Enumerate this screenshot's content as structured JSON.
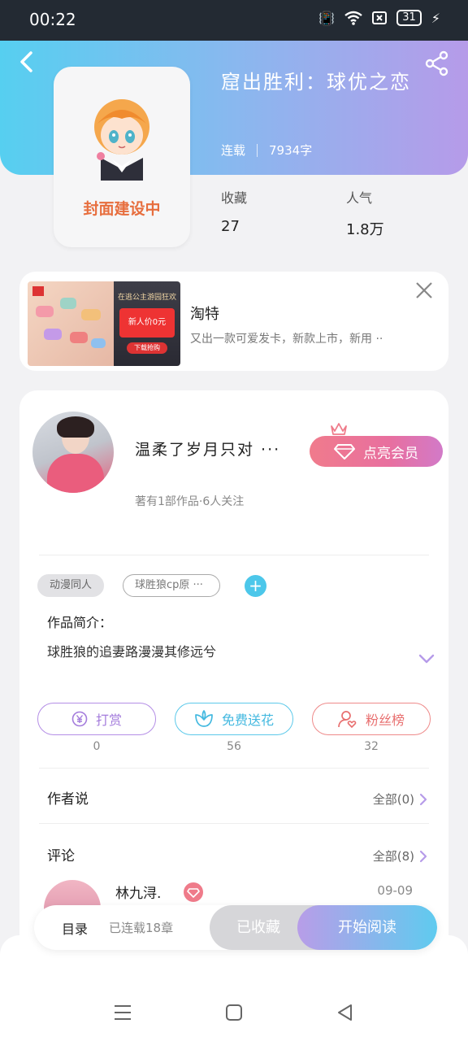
{
  "status_bar": {
    "time": "00:22",
    "battery": "31"
  },
  "book": {
    "title": "窟出胜利：球优之恋",
    "status": "连载",
    "word_count": "7934字",
    "cover_text": "封面建设中",
    "stats": [
      {
        "label": "收藏",
        "value": "27"
      },
      {
        "label": "人气",
        "value": "1.8万"
      }
    ]
  },
  "ad": {
    "title": "淘特",
    "description": "又出一款可爱发卡，新款上市，新用 ··",
    "image_top_text": "在逃公主游园狂欢",
    "image_badge_text": "新人价0元",
    "image_button_text": "下载抢购"
  },
  "author": {
    "name": "温柔了岁月只对 ···",
    "info": "著有1部作品·6人关注",
    "vip_button": "点亮会员"
  },
  "tags": [
    "动漫同人",
    "球胜狼cp原 ···"
  ],
  "intro": {
    "label": "作品简介：",
    "text": "球胜狼的追妻路漫漫其修远兮"
  },
  "actions": [
    {
      "label": "打赏",
      "count": "0"
    },
    {
      "label": "免费送花",
      "count": "56"
    },
    {
      "label": "粉丝榜",
      "count": "32"
    }
  ],
  "author_says": {
    "title": "作者说",
    "more": "全部(0)"
  },
  "comments": {
    "title": "评论",
    "more": "全部(8)",
    "first": {
      "user": "林九浔.",
      "date": "09-09"
    }
  },
  "bottom_bar": {
    "toc_label": "目录",
    "toc_status": "已连载18章",
    "collected": "已收藏",
    "read": "开始阅读"
  },
  "colors": {
    "accent_purple": "#b69be9",
    "accent_blue": "#56cff0",
    "cover_text": "#e76e3e"
  }
}
